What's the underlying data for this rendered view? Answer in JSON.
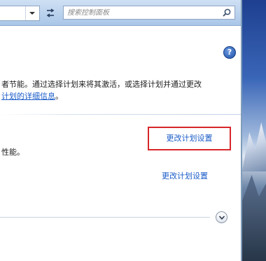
{
  "search": {
    "placeholder": "搜索控制面板"
  },
  "help": {
    "glyph": "?"
  },
  "intro": {
    "line1": "者节能。通过选择计划来将其激活，或选择计划并通过更改",
    "line2_link": "计划的详细信息",
    "line2_tail": "。"
  },
  "plans": [
    {
      "change_label": "更改计划设置",
      "description": "性能。"
    },
    {
      "change_label": "更改计划设置"
    }
  ],
  "colors": {
    "link": "#1a5cc8",
    "highlight": "#d8262a"
  },
  "icons": [
    "chevron-down-icon",
    "refresh-icon",
    "search-icon",
    "help-icon",
    "expand-chevron-icon"
  ]
}
